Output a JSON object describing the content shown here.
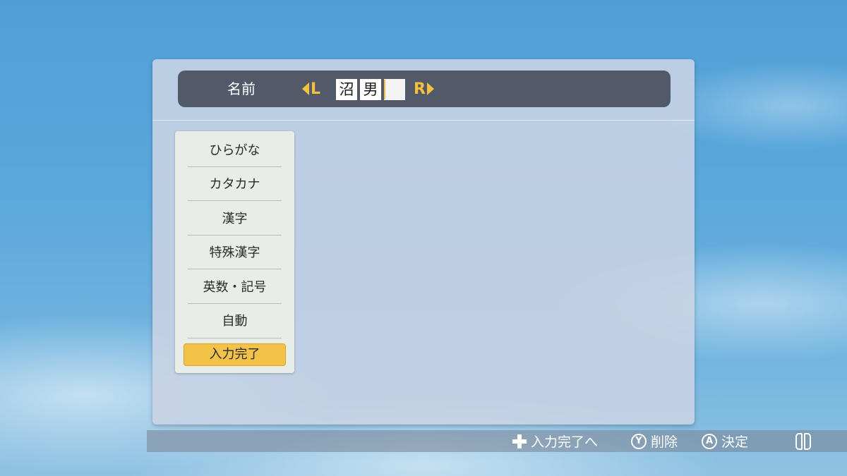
{
  "name_bar": {
    "label": "名前",
    "left_button": "L",
    "right_button": "R",
    "characters": [
      "沼",
      "男",
      ""
    ]
  },
  "menu": {
    "items": [
      {
        "label": "ひらがな"
      },
      {
        "label": "カタカナ"
      },
      {
        "label": "漢字"
      },
      {
        "label": "特殊漢字"
      },
      {
        "label": "英数・記号"
      },
      {
        "label": "自動"
      }
    ],
    "done_label": "入力完了"
  },
  "controls": {
    "plus_hint": "入力完了へ",
    "y_button": "Y",
    "y_hint": "削除",
    "a_button": "A",
    "a_hint": "決定",
    "joycon_icon": "joycon-icon"
  },
  "colors": {
    "accent_yellow": "#f4c23a",
    "name_bar_bg": "#525a6a",
    "done_button_bg": "#f3c349"
  }
}
